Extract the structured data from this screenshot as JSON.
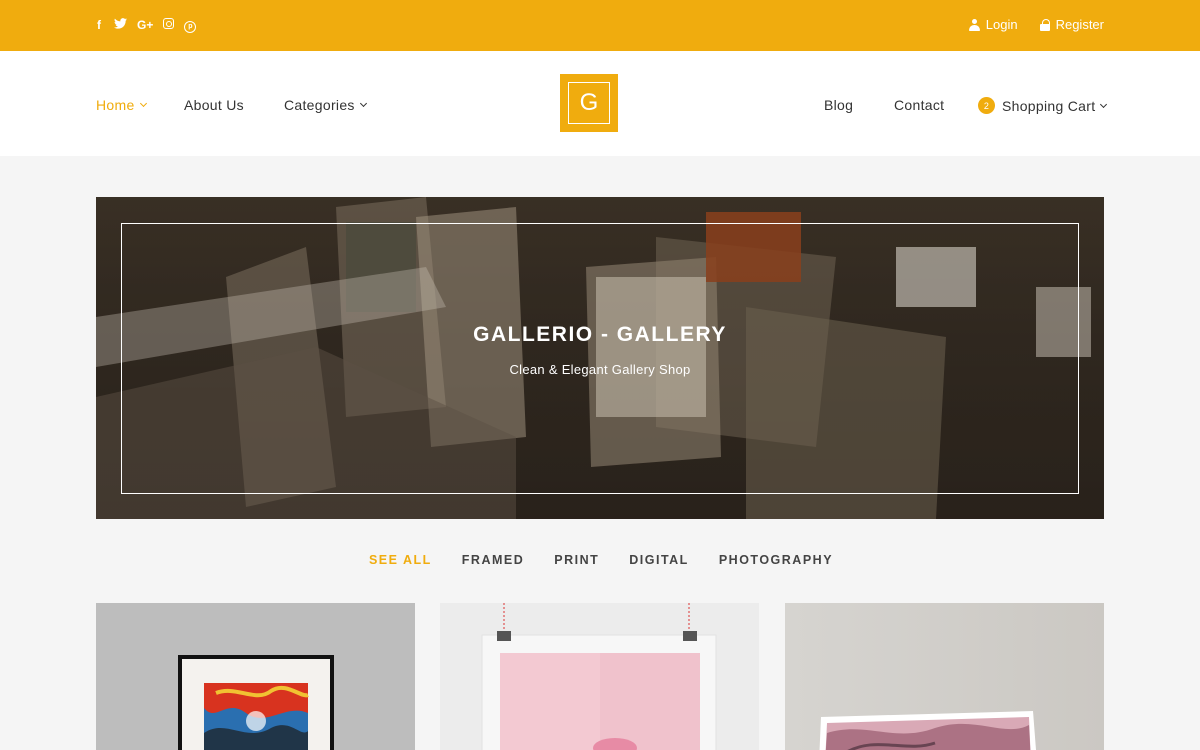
{
  "topbar": {
    "social_icons": [
      "facebook-icon",
      "twitter-icon",
      "google-plus-icon",
      "instagram-icon",
      "pinterest-icon"
    ],
    "login_label": "Login",
    "register_label": "Register"
  },
  "nav": {
    "home": "Home",
    "about": "About Us",
    "categories": "Categories",
    "blog": "Blog",
    "contact": "Contact",
    "cart": "Shopping Cart",
    "cart_count": "2"
  },
  "logo": {
    "letter": "G"
  },
  "hero": {
    "title": "GALLERIO - GALLERY",
    "subtitle": "Clean & Elegant Gallery Shop"
  },
  "filters": [
    "SEE ALL",
    "FRAMED",
    "PRINT",
    "DIGITAL",
    "PHOTOGRAPHY"
  ],
  "colors": {
    "accent": "#f0ac0e",
    "text": "#333333",
    "background": "#f5f5f5"
  }
}
